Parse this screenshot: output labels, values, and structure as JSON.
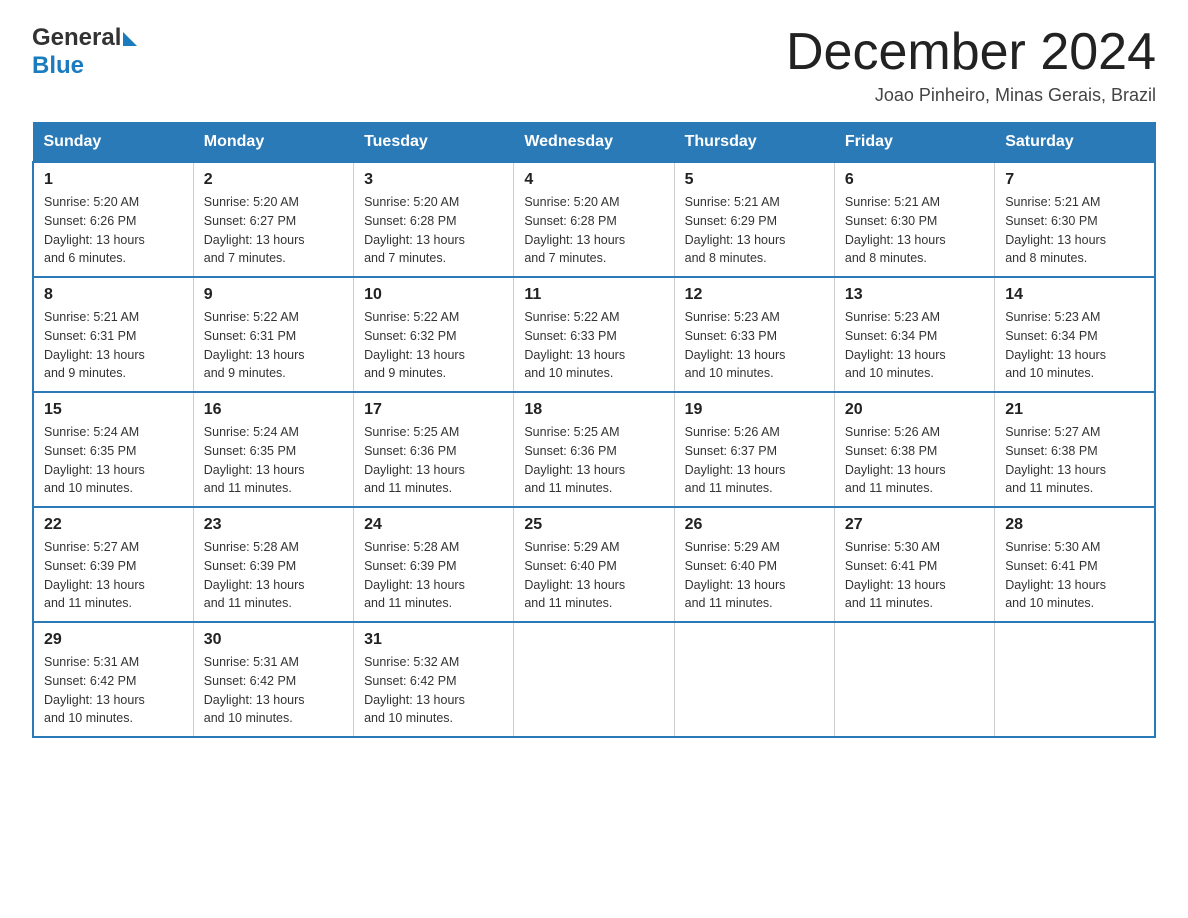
{
  "header": {
    "logo_general": "General",
    "logo_blue": "Blue",
    "title": "December 2024",
    "location": "Joao Pinheiro, Minas Gerais, Brazil"
  },
  "days_of_week": [
    "Sunday",
    "Monday",
    "Tuesday",
    "Wednesday",
    "Thursday",
    "Friday",
    "Saturday"
  ],
  "weeks": [
    [
      {
        "day": "1",
        "sunrise": "5:20 AM",
        "sunset": "6:26 PM",
        "daylight": "13 hours and 6 minutes."
      },
      {
        "day": "2",
        "sunrise": "5:20 AM",
        "sunset": "6:27 PM",
        "daylight": "13 hours and 7 minutes."
      },
      {
        "day": "3",
        "sunrise": "5:20 AM",
        "sunset": "6:28 PM",
        "daylight": "13 hours and 7 minutes."
      },
      {
        "day": "4",
        "sunrise": "5:20 AM",
        "sunset": "6:28 PM",
        "daylight": "13 hours and 7 minutes."
      },
      {
        "day": "5",
        "sunrise": "5:21 AM",
        "sunset": "6:29 PM",
        "daylight": "13 hours and 8 minutes."
      },
      {
        "day": "6",
        "sunrise": "5:21 AM",
        "sunset": "6:30 PM",
        "daylight": "13 hours and 8 minutes."
      },
      {
        "day": "7",
        "sunrise": "5:21 AM",
        "sunset": "6:30 PM",
        "daylight": "13 hours and 8 minutes."
      }
    ],
    [
      {
        "day": "8",
        "sunrise": "5:21 AM",
        "sunset": "6:31 PM",
        "daylight": "13 hours and 9 minutes."
      },
      {
        "day": "9",
        "sunrise": "5:22 AM",
        "sunset": "6:31 PM",
        "daylight": "13 hours and 9 minutes."
      },
      {
        "day": "10",
        "sunrise": "5:22 AM",
        "sunset": "6:32 PM",
        "daylight": "13 hours and 9 minutes."
      },
      {
        "day": "11",
        "sunrise": "5:22 AM",
        "sunset": "6:33 PM",
        "daylight": "13 hours and 10 minutes."
      },
      {
        "day": "12",
        "sunrise": "5:23 AM",
        "sunset": "6:33 PM",
        "daylight": "13 hours and 10 minutes."
      },
      {
        "day": "13",
        "sunrise": "5:23 AM",
        "sunset": "6:34 PM",
        "daylight": "13 hours and 10 minutes."
      },
      {
        "day": "14",
        "sunrise": "5:23 AM",
        "sunset": "6:34 PM",
        "daylight": "13 hours and 10 minutes."
      }
    ],
    [
      {
        "day": "15",
        "sunrise": "5:24 AM",
        "sunset": "6:35 PM",
        "daylight": "13 hours and 10 minutes."
      },
      {
        "day": "16",
        "sunrise": "5:24 AM",
        "sunset": "6:35 PM",
        "daylight": "13 hours and 11 minutes."
      },
      {
        "day": "17",
        "sunrise": "5:25 AM",
        "sunset": "6:36 PM",
        "daylight": "13 hours and 11 minutes."
      },
      {
        "day": "18",
        "sunrise": "5:25 AM",
        "sunset": "6:36 PM",
        "daylight": "13 hours and 11 minutes."
      },
      {
        "day": "19",
        "sunrise": "5:26 AM",
        "sunset": "6:37 PM",
        "daylight": "13 hours and 11 minutes."
      },
      {
        "day": "20",
        "sunrise": "5:26 AM",
        "sunset": "6:38 PM",
        "daylight": "13 hours and 11 minutes."
      },
      {
        "day": "21",
        "sunrise": "5:27 AM",
        "sunset": "6:38 PM",
        "daylight": "13 hours and 11 minutes."
      }
    ],
    [
      {
        "day": "22",
        "sunrise": "5:27 AM",
        "sunset": "6:39 PM",
        "daylight": "13 hours and 11 minutes."
      },
      {
        "day": "23",
        "sunrise": "5:28 AM",
        "sunset": "6:39 PM",
        "daylight": "13 hours and 11 minutes."
      },
      {
        "day": "24",
        "sunrise": "5:28 AM",
        "sunset": "6:39 PM",
        "daylight": "13 hours and 11 minutes."
      },
      {
        "day": "25",
        "sunrise": "5:29 AM",
        "sunset": "6:40 PM",
        "daylight": "13 hours and 11 minutes."
      },
      {
        "day": "26",
        "sunrise": "5:29 AM",
        "sunset": "6:40 PM",
        "daylight": "13 hours and 11 minutes."
      },
      {
        "day": "27",
        "sunrise": "5:30 AM",
        "sunset": "6:41 PM",
        "daylight": "13 hours and 11 minutes."
      },
      {
        "day": "28",
        "sunrise": "5:30 AM",
        "sunset": "6:41 PM",
        "daylight": "13 hours and 10 minutes."
      }
    ],
    [
      {
        "day": "29",
        "sunrise": "5:31 AM",
        "sunset": "6:42 PM",
        "daylight": "13 hours and 10 minutes."
      },
      {
        "day": "30",
        "sunrise": "5:31 AM",
        "sunset": "6:42 PM",
        "daylight": "13 hours and 10 minutes."
      },
      {
        "day": "31",
        "sunrise": "5:32 AM",
        "sunset": "6:42 PM",
        "daylight": "13 hours and 10 minutes."
      },
      null,
      null,
      null,
      null
    ]
  ],
  "labels": {
    "sunrise": "Sunrise:",
    "sunset": "Sunset:",
    "daylight": "Daylight:"
  }
}
